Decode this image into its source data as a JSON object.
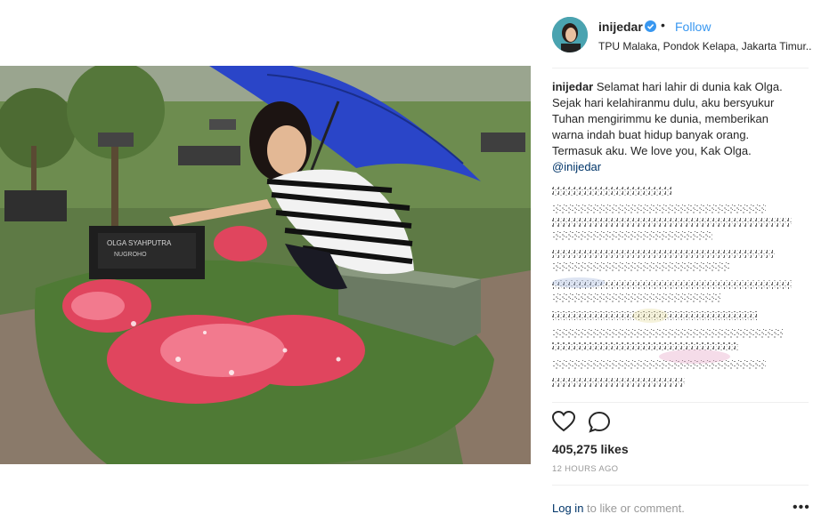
{
  "post": {
    "username": "inijedar",
    "separator": "•",
    "follow_label": "Follow",
    "location": "TPU Malaka, Pondok Kelapa, Jakarta Timur..."
  },
  "caption": {
    "username": "inijedar",
    "text": " Selamat hari lahir di dunia kak Olga. Sejak hari kelahiranmu dulu, aku bersyukur Tuhan mengirimmu ke dunia, memberikan warna indah buat hidup banyak orang. Termasuk aku. We love you, Kak Olga. ",
    "mention": "@inijedar"
  },
  "stats": {
    "likes": "405,275 likes",
    "time": "12 HOURS AGO"
  },
  "footer": {
    "login_link": "Log in",
    "login_rest": " to like or comment.",
    "more": "•••"
  },
  "colors": {
    "accent": "#3897f0",
    "mention": "#003569",
    "muted": "#999999"
  }
}
